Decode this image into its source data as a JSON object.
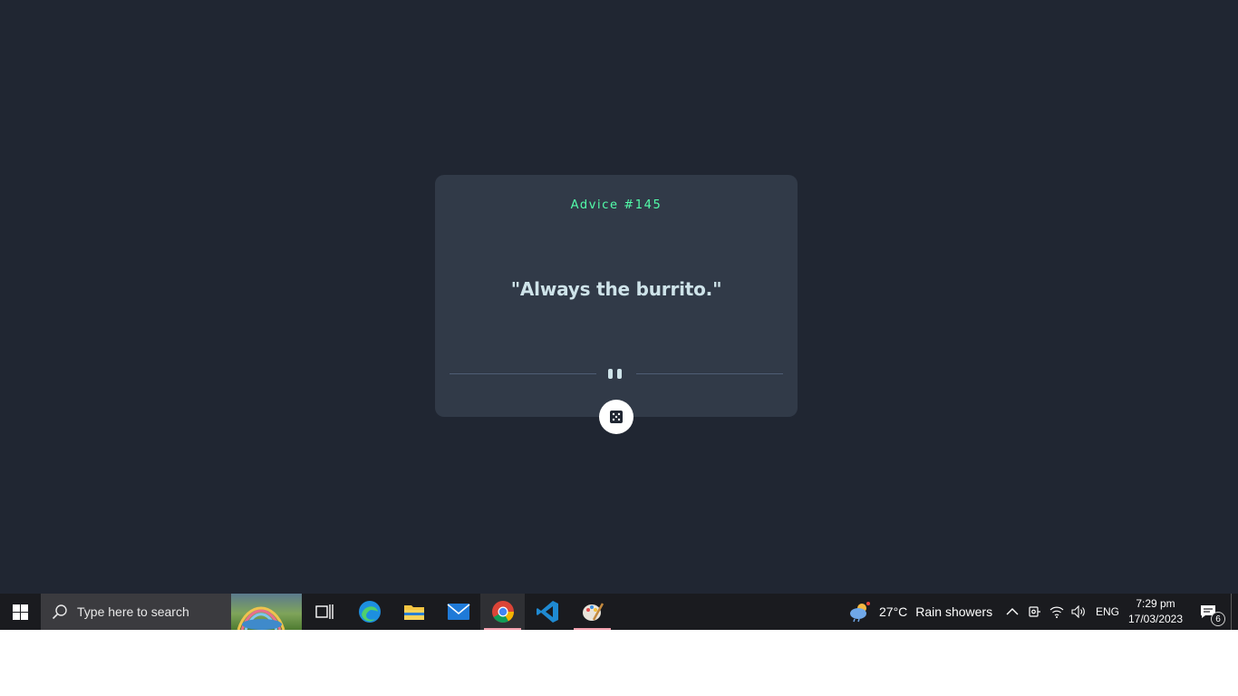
{
  "advice": {
    "heading": "Advice #145",
    "quote": "\"Always the burrito.\""
  },
  "colors": {
    "background": "#202632",
    "card": "#313a48",
    "accent_green": "#53ffab",
    "text_light": "#cee3e9",
    "divider": "#4f5d74",
    "taskbar": "#1a1b1f"
  },
  "taskbar": {
    "search_placeholder": "Type here to search",
    "apps": [
      {
        "name": "task-view-icon"
      },
      {
        "name": "edge-icon"
      },
      {
        "name": "file-explorer-icon"
      },
      {
        "name": "mail-icon"
      },
      {
        "name": "chrome-icon"
      },
      {
        "name": "vscode-icon"
      },
      {
        "name": "paint-icon"
      }
    ],
    "weather": {
      "temperature": "27°C",
      "condition": "Rain showers"
    },
    "language": "ENG",
    "time": "7:29 pm",
    "date": "17/03/2023",
    "notification_count": "6"
  }
}
